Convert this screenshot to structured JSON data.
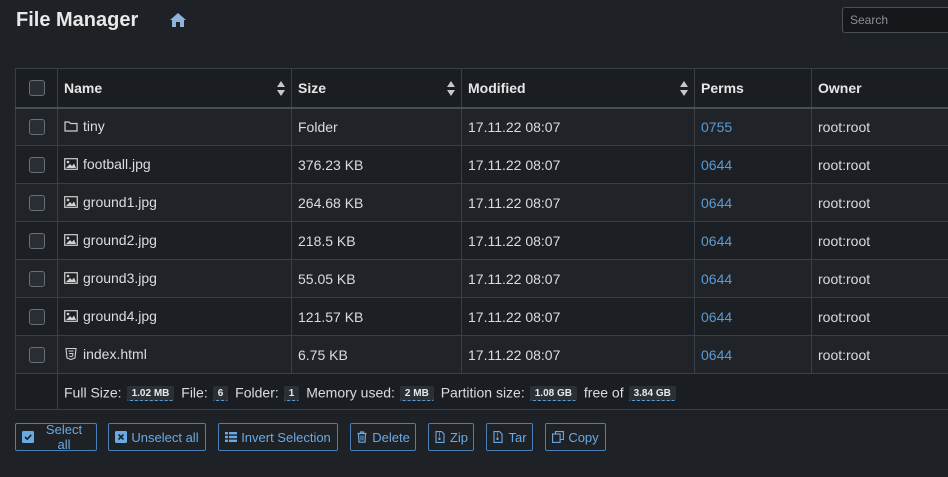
{
  "header": {
    "title": "File Manager",
    "home_icon": "home-icon",
    "search_placeholder": "Search"
  },
  "table": {
    "columns": [
      {
        "label": "Name",
        "sortable": true
      },
      {
        "label": "Size",
        "sortable": true
      },
      {
        "label": "Modified",
        "sortable": true
      },
      {
        "label": "Perms",
        "sortable": false
      },
      {
        "label": "Owner",
        "sortable": false
      }
    ],
    "rows": [
      {
        "icon": "folder-icon",
        "name": "tiny",
        "size": "Folder",
        "modified": "17.11.22 08:07",
        "perms": "0755",
        "owner": "root:root"
      },
      {
        "icon": "image-icon",
        "name": "football.jpg",
        "size": "376.23 KB",
        "modified": "17.11.22 08:07",
        "perms": "0644",
        "owner": "root:root"
      },
      {
        "icon": "image-icon",
        "name": "ground1.jpg",
        "size": "264.68 KB",
        "modified": "17.11.22 08:07",
        "perms": "0644",
        "owner": "root:root"
      },
      {
        "icon": "image-icon",
        "name": "ground2.jpg",
        "size": "218.5 KB",
        "modified": "17.11.22 08:07",
        "perms": "0644",
        "owner": "root:root"
      },
      {
        "icon": "image-icon",
        "name": "ground3.jpg",
        "size": "55.05 KB",
        "modified": "17.11.22 08:07",
        "perms": "0644",
        "owner": "root:root"
      },
      {
        "icon": "image-icon",
        "name": "ground4.jpg",
        "size": "121.57 KB",
        "modified": "17.11.22 08:07",
        "perms": "0644",
        "owner": "root:root"
      },
      {
        "icon": "html5-icon",
        "name": "index.html",
        "size": "6.75 KB",
        "modified": "17.11.22 08:07",
        "perms": "0644",
        "owner": "root:root"
      }
    ]
  },
  "footer": {
    "full_size_label": "Full Size:",
    "full_size": "1.02 MB",
    "file_label": "File:",
    "file_count": "6",
    "folder_label": "Folder:",
    "folder_count": "1",
    "memory_label": "Memory used:",
    "memory": "2 MB",
    "partition_label": "Partition size:",
    "partition": "1.08 GB",
    "free_label": "free of",
    "total": "3.84 GB"
  },
  "actions": [
    {
      "label": "Select all",
      "icon": "check-square-icon"
    },
    {
      "label": "Unselect all",
      "icon": "x-square-icon"
    },
    {
      "label": "Invert Selection",
      "icon": "list-icon"
    },
    {
      "label": "Delete",
      "icon": "trash-icon"
    },
    {
      "label": "Zip",
      "icon": "file-zip-icon"
    },
    {
      "label": "Tar",
      "icon": "file-zip-icon"
    },
    {
      "label": "Copy",
      "icon": "copy-icon"
    }
  ],
  "colors": {
    "background": "#1e2126",
    "link": "#5b9bd5",
    "button_border": "#4a7fb8",
    "button_text": "#6aaae4"
  }
}
